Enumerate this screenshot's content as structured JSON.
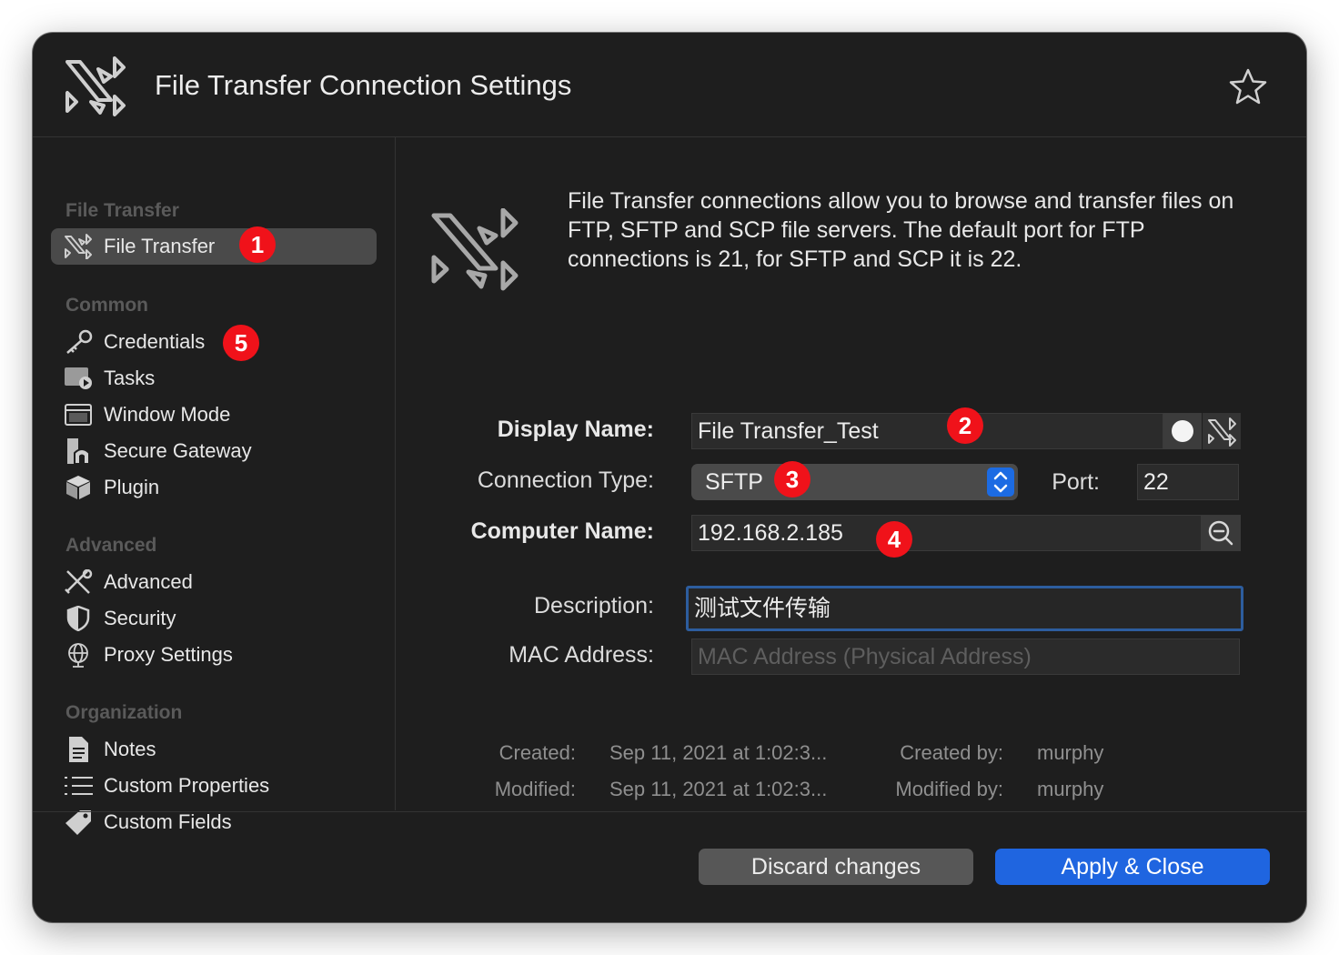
{
  "window": {
    "title": "File Transfer Connection Settings"
  },
  "sidebar": {
    "sections": {
      "file_transfer": "File Transfer",
      "common": "Common",
      "advanced": "Advanced",
      "organization": "Organization"
    },
    "items": {
      "file_transfer": "File Transfer",
      "credentials": "Credentials",
      "tasks": "Tasks",
      "window_mode": "Window Mode",
      "secure_gateway": "Secure Gateway",
      "plugin": "Plugin",
      "advanced": "Advanced",
      "security": "Security",
      "proxy_settings": "Proxy Settings",
      "notes": "Notes",
      "custom_properties": "Custom Properties",
      "custom_fields": "Custom Fields"
    },
    "selected": "File Transfer"
  },
  "annotations": {
    "b1": "1",
    "b2": "2",
    "b3": "3",
    "b4": "4",
    "b5": "5",
    "color": "#f0121a"
  },
  "main": {
    "intro": "File Transfer connections allow you to browse and transfer files on FTP, SFTP and SCP file servers. The default port for FTP connections is 21, for SFTP and SCP it is 22.",
    "form": {
      "display_name_label": "Display Name:",
      "display_name_value": "File Transfer_Test",
      "connection_type_label": "Connection Type:",
      "connection_type_value": "SFTP",
      "port_label": "Port:",
      "port_value": "22",
      "computer_name_label": "Computer Name:",
      "computer_name_value": "192.168.2.185",
      "description_label": "Description:",
      "description_value": "测试文件传输",
      "mac_address_label": "MAC Address:",
      "mac_address_placeholder": "MAC Address (Physical Address)"
    },
    "meta": {
      "created_label": "Created:",
      "created_value": "Sep 11, 2021 at 1:02:3...",
      "modified_label": "Modified:",
      "modified_value": "Sep 11, 2021 at 1:02:3...",
      "created_by_label": "Created by:",
      "created_by_value": "murphy",
      "modified_by_label": "Modified by:",
      "modified_by_value": "murphy"
    }
  },
  "footer": {
    "discard_label": "Discard changes",
    "apply_label": "Apply & Close"
  },
  "colors": {
    "accent": "#1f65e0",
    "window_bg": "#1e1e1e",
    "focus_ring": "#2d5d9e"
  }
}
